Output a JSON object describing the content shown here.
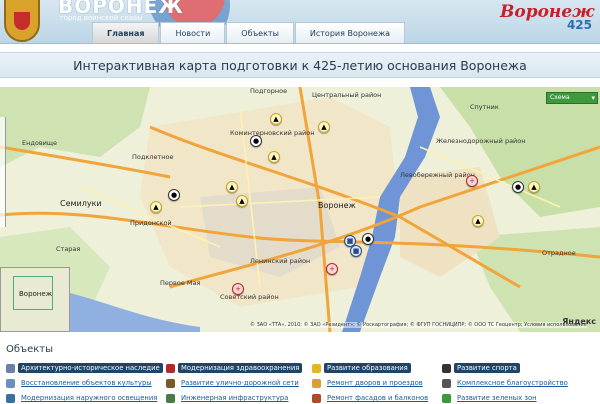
{
  "header": {
    "brand": "ВОРОНЕЖ",
    "brand_sub": "город воинской славы",
    "logo_word": "Воронеж",
    "logo_number": "425"
  },
  "nav": {
    "tabs": [
      {
        "label": "Главная",
        "active": true
      },
      {
        "label": "Новости",
        "active": false
      },
      {
        "label": "Объекты",
        "active": false
      },
      {
        "label": "История Воронежа",
        "active": false
      }
    ]
  },
  "page_title": "Интерактивная карта подготовки к 425-летию основания Воронежа",
  "map": {
    "layer_select": "Схема",
    "copyright": "© ЗАО «ТТА», 2010; © ЗАО «Резидент»; © Роскартография; © ФГУП ГОСНИЦИПР; © ООО ТС Геоцентр; Условия использования",
    "provider": "Яндекс",
    "minimap_label": "Воронеж",
    "labels": {
      "city": "Воронеж",
      "semiluki": "Семилуки",
      "pridonskoy": "Придонской",
      "podklyuchi": "Подклетное",
      "endovishche": "Ендовище",
      "starye": "Старая",
      "pervoe_maya": "Первое Мая",
      "otradnoe": "Отрадное",
      "podgornoe": "Подгорное",
      "kominternovsky": "Коминтерновский район",
      "leninsky": "Ленинский район",
      "sovetsky": "Советский район",
      "levoberezhny": "Левобережный район",
      "tsentralny": "Центральный район",
      "zheleznodorozhny": "Железнодорожный район",
      "sputnik": "Спутник"
    }
  },
  "legend": {
    "title": "Объекты",
    "items": [
      {
        "label": "Архитектурно-историческое наследие",
        "icon": "heritage-icon",
        "state": "selected",
        "color": "#6b7fa8"
      },
      {
        "label": "Модернизация здравоохранения",
        "icon": "medical-icon",
        "state": "selected",
        "color": "#b12a2a"
      },
      {
        "label": "Развитие образования",
        "icon": "education-icon",
        "state": "selected",
        "color": "#e0b62a"
      },
      {
        "label": "Развитие спорта",
        "icon": "sport-icon",
        "state": "selected",
        "color": "#333333"
      },
      {
        "label": "Восстановление объектов культуры",
        "icon": "culture-icon",
        "state": "plain",
        "color": "#6b8fc0"
      },
      {
        "label": "Развитие улично-дорожной сети",
        "icon": "road-icon",
        "state": "plain",
        "color": "#7a5a2a"
      },
      {
        "label": "Ремонт дворов и проездов",
        "icon": "yard-icon",
        "state": "plain",
        "color": "#d9a22a"
      },
      {
        "label": "Комплексное благоустройство",
        "icon": "landscaping-icon",
        "state": "plain",
        "color": "#555555"
      },
      {
        "label": "Модернизация наружного освещения",
        "icon": "lighting-icon",
        "state": "plain",
        "color": "#3a6fa0"
      },
      {
        "label": "Инженерная инфраструктура",
        "icon": "engineering-icon",
        "state": "plain",
        "color": "#4a7a4a"
      },
      {
        "label": "Ремонт фасадов и балконов",
        "icon": "facade-icon",
        "state": "plain",
        "color": "#b04a2a"
      },
      {
        "label": "Развитие зеленых зон",
        "icon": "green-zone-icon",
        "state": "plain",
        "color": "#3a9a3a"
      }
    ]
  }
}
